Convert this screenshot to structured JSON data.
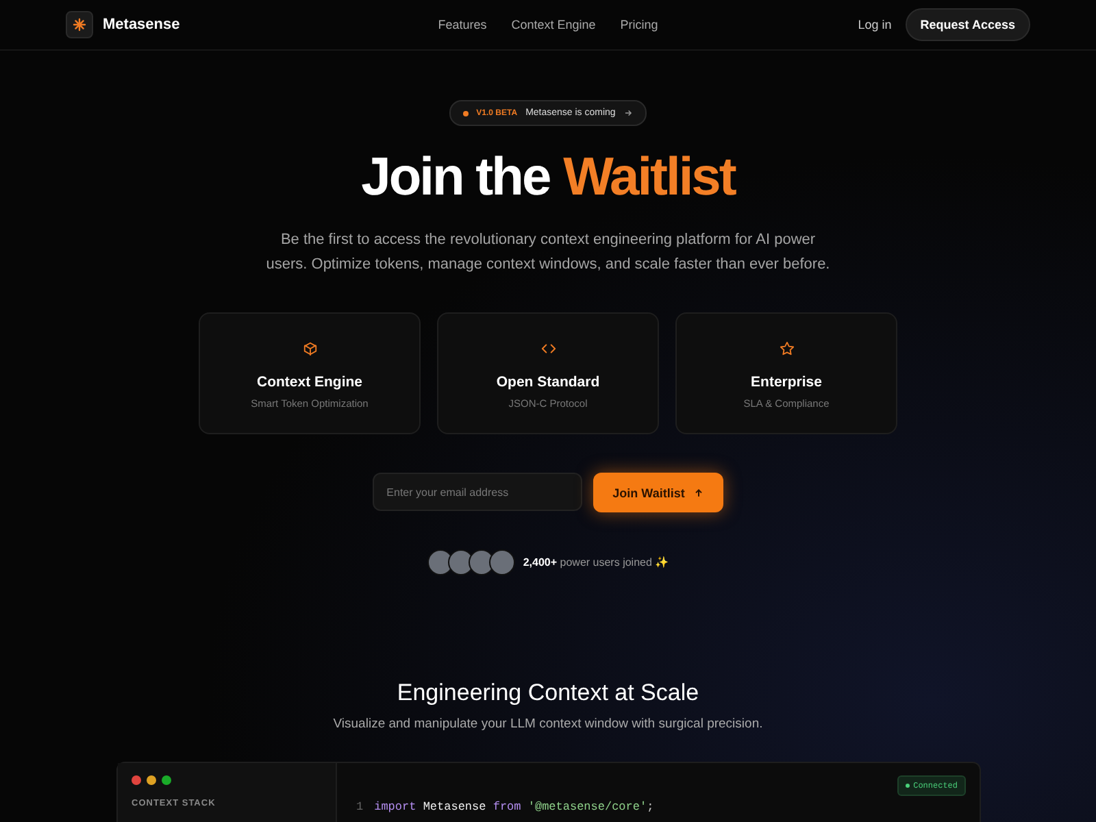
{
  "nav": {
    "brand": "Metasense",
    "links": [
      "Features",
      "Context Engine",
      "Pricing"
    ],
    "login": "Log in",
    "cta": "Request Access"
  },
  "badge": {
    "tag": "V1.0 BETA",
    "text": "Metasense is coming"
  },
  "hero": {
    "title": "Join the",
    "highlight": "Waitlist",
    "subtitle": "Be the first to access the revolutionary context engineering platform for AI power users. Optimize tokens, manage context windows, and scale faster than ever before."
  },
  "features": [
    {
      "kind": "cube",
      "title": "Context Engine",
      "subtitle": "Smart Token Optimization"
    },
    {
      "kind": "code",
      "title": "Open Standard",
      "subtitle": "JSON-C Protocol"
    },
    {
      "kind": "star",
      "title": "Enterprise",
      "subtitle": "SLA & Compliance"
    }
  ],
  "signup": {
    "placeholder": "Enter your email address",
    "button": "Join Waitlist"
  },
  "social": {
    "text": "**2,400+** power users joined ✨"
  },
  "section": {
    "title": "Engineering Context at Scale",
    "subtitle": "Visualize and manipulate your LLM context window with surgical precision."
  },
  "editor": {
    "sidebar_title": "CONTEXT STACK",
    "status": "Connected",
    "lines": [
      {
        "number": "1",
        "tokens": [
          {
            "kind": "keyword",
            "text": "import"
          },
          {
            "kind": "plain",
            "text": "Metasense"
          },
          {
            "kind": "keyword",
            "text": "from"
          },
          {
            "kind": "string",
            "text": "'@metasense/core'"
          },
          {
            "kind": "punct",
            "text": ";"
          }
        ]
      }
    ]
  }
}
